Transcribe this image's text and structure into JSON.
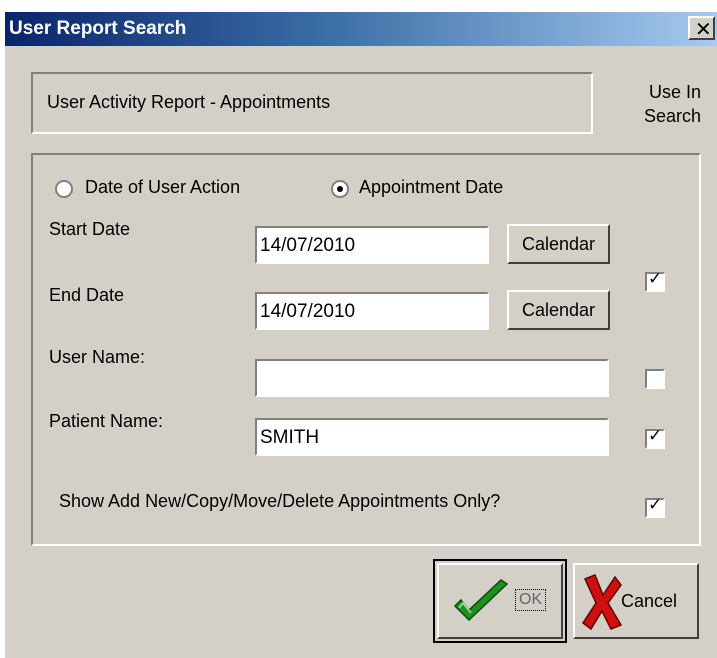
{
  "window": {
    "title": "User Report Search",
    "close_icon": "close-icon"
  },
  "header": {
    "report_name": "User Activity Report - Appointments",
    "use_in_search_line1": "Use In",
    "use_in_search_line2": "Search"
  },
  "criteria": {
    "date_type": {
      "option_user_action": "Date of User Action",
      "option_appointment": "Appointment Date",
      "selected": "Appointment Date"
    },
    "start_date": {
      "label": "Start Date",
      "value": "14/07/2010",
      "calendar_label": "Calendar"
    },
    "end_date": {
      "label": "End Date",
      "value": "14/07/2010",
      "calendar_label": "Calendar"
    },
    "dates_use_in_search": true,
    "user_name": {
      "label": "User Name:",
      "value": "",
      "use_in_search": false
    },
    "patient_name": {
      "label": "Patient Name:",
      "value": "SMITH",
      "use_in_search": true
    },
    "show_add_new": {
      "label": "Show Add New/Copy/Move/Delete Appointments Only?",
      "checked": true
    }
  },
  "buttons": {
    "ok_label": "OK",
    "cancel_label": "Cancel",
    "ok_icon": "green-checkmark-icon",
    "cancel_icon": "red-x-icon"
  },
  "colors": {
    "titlebar_start": "#0a246a",
    "titlebar_end": "#a6caf0",
    "dialog_bg": "#d4d0c8",
    "ok_green": "#2e9e2e",
    "cancel_red": "#d01010"
  }
}
